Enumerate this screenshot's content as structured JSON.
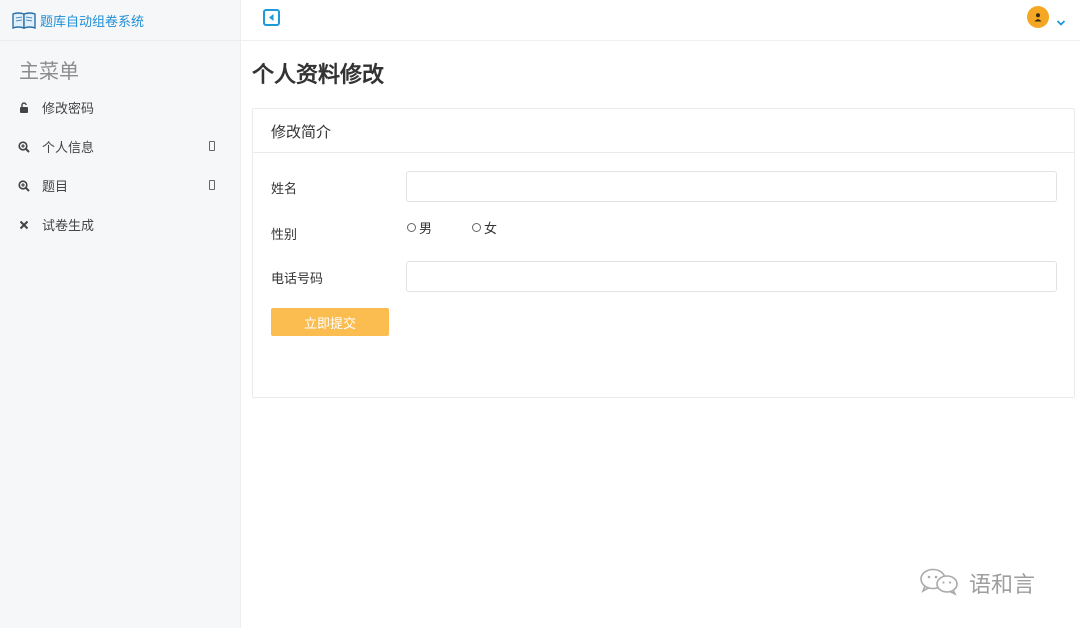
{
  "app": {
    "title": "题库自动组卷系统"
  },
  "sidebar": {
    "heading": "主菜单",
    "items": [
      {
        "label": "修改密码",
        "icon": "unlock-icon",
        "has_caret": false
      },
      {
        "label": "个人信息",
        "icon": "zoom-icon",
        "has_caret": true
      },
      {
        "label": "题目",
        "icon": "zoom-icon",
        "has_caret": true
      },
      {
        "label": "试卷生成",
        "icon": "close-icon",
        "has_caret": false
      }
    ]
  },
  "topbar": {
    "toggle_icon": "sidebar-toggle-icon",
    "avatar_icon": "user-icon",
    "dropdown_icon": "chevron-down-icon"
  },
  "page": {
    "title": "个人资料修改"
  },
  "form": {
    "panel_title": "修改简介",
    "name_label": "姓名",
    "name_value": "",
    "gender_label": "性别",
    "gender_options": [
      "男",
      "女"
    ],
    "phone_label": "电话号码",
    "phone_value": "",
    "submit_label": "立即提交"
  },
  "watermark": {
    "text": "语和言"
  },
  "colors": {
    "brand": "#1e8fd6",
    "accent": "#fbbd4f",
    "avatar": "#f5a623"
  }
}
